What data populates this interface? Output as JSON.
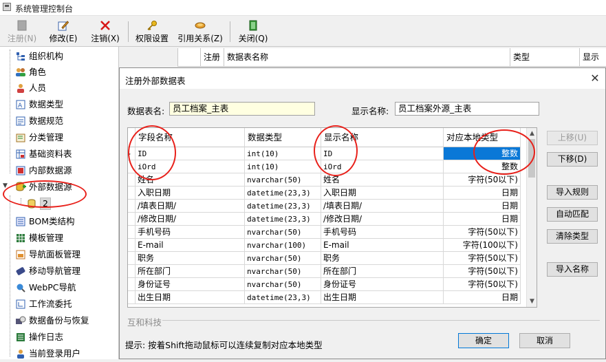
{
  "window": {
    "title": "系统管理控制台"
  },
  "toolbar": {
    "items": [
      {
        "label": "注册(N)",
        "icon": "register-icon",
        "enabled": false
      },
      {
        "label": "修改(E)",
        "icon": "edit-icon",
        "enabled": true
      },
      {
        "label": "注销(X)",
        "icon": "delete-icon",
        "enabled": true
      },
      {
        "label": "权限设置",
        "icon": "key-icon",
        "enabled": true
      },
      {
        "label": "引用关系(Z)",
        "icon": "reference-icon",
        "enabled": true
      },
      {
        "label": "关闭(Q)",
        "icon": "close-door-icon",
        "enabled": true
      }
    ]
  },
  "tree": {
    "items": [
      {
        "label": "组织机构",
        "icon": "org-tree-icon"
      },
      {
        "label": "角色",
        "icon": "role-icon"
      },
      {
        "label": "人员",
        "icon": "person-icon"
      },
      {
        "label": "数据类型",
        "icon": "data-type-icon"
      },
      {
        "label": "数据规范",
        "icon": "data-spec-icon"
      },
      {
        "label": "分类管理",
        "icon": "category-icon"
      },
      {
        "label": "基础资料表",
        "icon": "basic-table-icon"
      },
      {
        "label": "内部数据源",
        "icon": "internal-source-icon"
      },
      {
        "label": "外部数据源",
        "icon": "external-source-icon"
      },
      {
        "label": "2",
        "icon": "database-icon"
      },
      {
        "label": "BOM类结构",
        "icon": "bom-icon"
      },
      {
        "label": "模板管理",
        "icon": "template-icon"
      },
      {
        "label": "导航面板管理",
        "icon": "nav-panel-icon"
      },
      {
        "label": "移动导航管理",
        "icon": "mobile-nav-icon"
      },
      {
        "label": "WebPC导航",
        "icon": "web-nav-icon"
      },
      {
        "label": "工作流委托",
        "icon": "workflow-icon"
      },
      {
        "label": "数据备份与恢复",
        "icon": "backup-icon"
      },
      {
        "label": "操作日志",
        "icon": "log-icon"
      },
      {
        "label": "当前登录用户",
        "icon": "online-user-icon"
      }
    ]
  },
  "bg_grid": {
    "headers": [
      "注册",
      "数据表名称",
      "类型",
      "显示名"
    ]
  },
  "dialog": {
    "title": "注册外部数据表",
    "table_name_label": "数据表名:",
    "table_name_value": "员工档案_主表",
    "display_name_label": "显示名称:",
    "display_name_value": "员工档案外源_主表",
    "grid": {
      "headers": [
        "字段名称",
        "数据类型",
        "显示名称",
        "对应本地类型"
      ],
      "rows": [
        [
          "ID",
          "int(10)",
          "ID",
          "整数"
        ],
        [
          "iOrd",
          "int(10)",
          "iOrd",
          "整数"
        ],
        [
          "姓名",
          "nvarchar(50)",
          "姓名",
          "字符(50以下)"
        ],
        [
          "入职日期",
          "datetime(23,3)",
          "入职日期",
          "日期"
        ],
        [
          "/填表日期/",
          "datetime(23,3)",
          "/填表日期/",
          "日期"
        ],
        [
          "/修改日期/",
          "datetime(23,3)",
          "/修改日期/",
          "日期"
        ],
        [
          "手机号码",
          "nvarchar(50)",
          "手机号码",
          "字符(50以下)"
        ],
        [
          "E-mail",
          "nvarchar(100)",
          "E-mail",
          "字符(100以下)"
        ],
        [
          "职务",
          "nvarchar(50)",
          "职务",
          "字符(50以下)"
        ],
        [
          "所在部门",
          "nvarchar(50)",
          "所在部门",
          "字符(50以下)"
        ],
        [
          "身份证号",
          "nvarchar(50)",
          "身份证号",
          "字符(50以下)"
        ],
        [
          "出生日期",
          "datetime(23,3)",
          "出生日期",
          "日期"
        ]
      ]
    },
    "side_buttons": [
      "上移(U)",
      "下移(D)",
      "导入规则",
      "自动匹配",
      "清除类型",
      "导入名称"
    ],
    "brand": "互和科技",
    "hint": "提示: 按着Shift拖动鼠标可以连续复制对应本地类型",
    "ok_label": "确定",
    "cancel_label": "取消"
  },
  "colors": {
    "accent": "#0a78d7",
    "annotation": "#e8201a",
    "input_bg": "#ffffe1"
  }
}
